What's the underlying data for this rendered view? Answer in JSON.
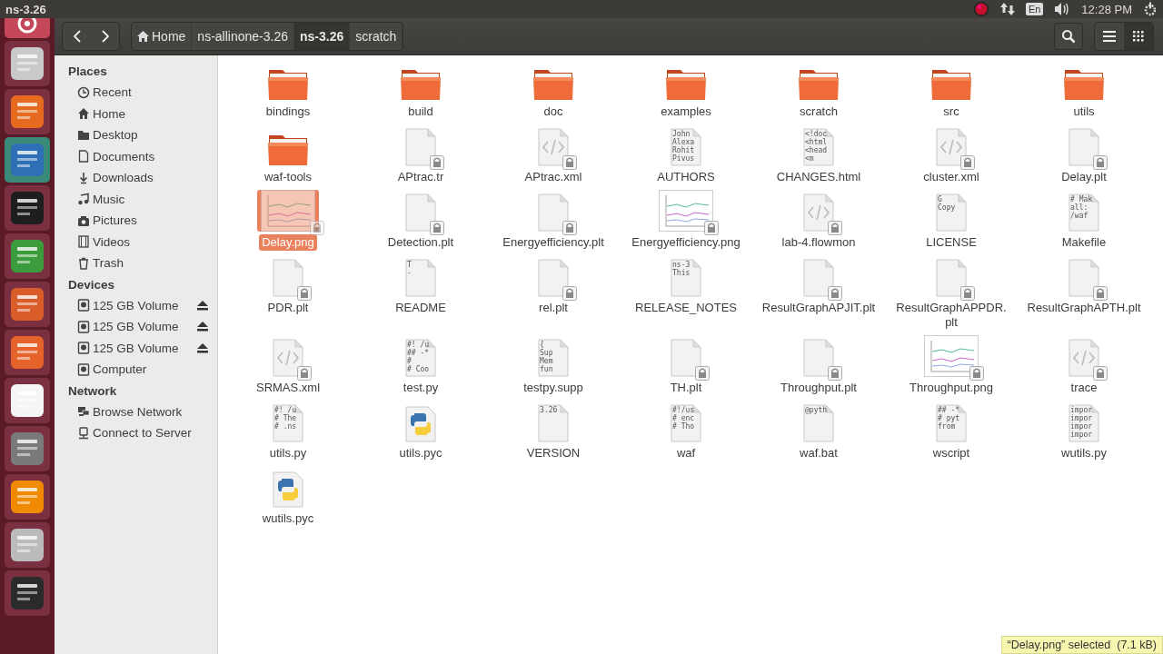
{
  "top_panel": {
    "title": "ns-3.26",
    "keyboard": "En",
    "clock": "12:28 PM"
  },
  "toolbar": {
    "path": [
      {
        "label": "Home",
        "selected": false
      },
      {
        "label": "ns-allinone-3.26",
        "selected": false
      },
      {
        "label": "ns-3.26",
        "selected": true
      },
      {
        "label": "scratch",
        "selected": false
      }
    ],
    "views": [
      {
        "kind": "list",
        "selected": false
      },
      {
        "kind": "grid",
        "selected": true
      }
    ]
  },
  "sidebar": {
    "sections": [
      {
        "title": "Places",
        "items": [
          {
            "label": "Recent"
          },
          {
            "label": "Home"
          },
          {
            "label": "Desktop"
          },
          {
            "label": "Documents"
          },
          {
            "label": "Downloads"
          },
          {
            "label": "Music"
          },
          {
            "label": "Pictures"
          },
          {
            "label": "Videos"
          },
          {
            "label": "Trash"
          }
        ]
      },
      {
        "title": "Devices",
        "items": [
          {
            "label": "125 GB Volume",
            "ejectable": true
          },
          {
            "label": "125 GB Volume",
            "ejectable": true
          },
          {
            "label": "125 GB Volume",
            "ejectable": true
          },
          {
            "label": "Computer",
            "ejectable": false
          }
        ]
      },
      {
        "title": "Network",
        "items": [
          {
            "label": "Browse Network"
          },
          {
            "label": "Connect to Server"
          }
        ]
      }
    ]
  },
  "files": [
    {
      "name": "bindings",
      "kind": "folder",
      "selected": false
    },
    {
      "name": "build",
      "kind": "folder",
      "selected": false
    },
    {
      "name": "doc",
      "kind": "folder",
      "selected": false
    },
    {
      "name": "examples",
      "kind": "folder",
      "selected": false
    },
    {
      "name": "scratch",
      "kind": "folder",
      "selected": false
    },
    {
      "name": "src",
      "kind": "folder",
      "selected": false
    },
    {
      "name": "utils",
      "kind": "folder",
      "selected": false
    },
    {
      "name": "waf-tools",
      "kind": "folder",
      "selected": false
    },
    {
      "name": "APtrac.tr",
      "kind": "document",
      "locked": true,
      "selected": false
    },
    {
      "name": "APtrac.xml",
      "kind": "code",
      "locked": true,
      "selected": false
    },
    {
      "name": "AUTHORS",
      "kind": "text",
      "preview": [
        "John",
        "Alexa",
        "Rohit",
        "Pivus"
      ],
      "locked": false,
      "selected": false
    },
    {
      "name": "CHANGES.html",
      "kind": "text",
      "preview": [
        "<!doc",
        "<html",
        "<head",
        "<m"
      ],
      "locked": false,
      "selected": false
    },
    {
      "name": "cluster.xml",
      "kind": "code",
      "locked": true,
      "selected": false
    },
    {
      "name": "Delay.plt",
      "kind": "document",
      "locked": true,
      "selected": false
    },
    {
      "name": "Delay.png",
      "kind": "image",
      "locked": true,
      "selected": true
    },
    {
      "name": "Detection.plt",
      "kind": "document",
      "locked": true,
      "selected": false
    },
    {
      "name": "Energyefficiency.plt",
      "kind": "document",
      "locked": true,
      "selected": false
    },
    {
      "name": "Energyefficiency.png",
      "kind": "image",
      "locked": true,
      "selected": false
    },
    {
      "name": "lab-4.flowmon",
      "kind": "code",
      "locked": true,
      "selected": false
    },
    {
      "name": "LICENSE",
      "kind": "text",
      "preview": [
        "G",
        "Copy"
      ],
      "locked": false,
      "selected": false
    },
    {
      "name": "Makefile",
      "kind": "text",
      "preview": [
        "# Mak",
        "all:",
        "/waf"
      ],
      "locked": false,
      "selected": false
    },
    {
      "name": "PDR.plt",
      "kind": "document",
      "locked": true,
      "selected": false
    },
    {
      "name": "README",
      "kind": "text",
      "preview": [
        "T",
        "-"
      ],
      "locked": false,
      "selected": false
    },
    {
      "name": "rel.plt",
      "kind": "document",
      "locked": true,
      "selected": false
    },
    {
      "name": "RELEASE_NOTES",
      "kind": "text",
      "preview": [
        "ns-3",
        "This"
      ],
      "locked": false,
      "selected": false
    },
    {
      "name": "ResultGraphAPJIT.plt",
      "kind": "document",
      "locked": true,
      "selected": false
    },
    {
      "name": "ResultGraphAPPDR.plt",
      "kind": "document",
      "locked": true,
      "selected": false
    },
    {
      "name": "ResultGraphAPTH.plt",
      "kind": "document",
      "locked": true,
      "selected": false
    },
    {
      "name": "SRMAS.xml",
      "kind": "code",
      "locked": true,
      "selected": false
    },
    {
      "name": "test.py",
      "kind": "text",
      "preview": [
        "#! /u",
        "## -*",
        "#",
        "# Coo"
      ],
      "locked": false,
      "selected": false
    },
    {
      "name": "testpy.supp",
      "kind": "text",
      "preview": [
        "{",
        "Sup",
        "Mem",
        "fun"
      ],
      "locked": false,
      "selected": false
    },
    {
      "name": "TH.plt",
      "kind": "document",
      "locked": true,
      "selected": false
    },
    {
      "name": "Throughput.plt",
      "kind": "document",
      "locked": true,
      "selected": false
    },
    {
      "name": "Throughput.png",
      "kind": "image",
      "locked": true,
      "selected": false
    },
    {
      "name": "trace",
      "kind": "code",
      "locked": true,
      "selected": false
    },
    {
      "name": "utils.py",
      "kind": "text",
      "preview": [
        "#! /u",
        "# The",
        "# .ns"
      ],
      "locked": false,
      "selected": false
    },
    {
      "name": "utils.pyc",
      "kind": "python",
      "selected": false
    },
    {
      "name": "VERSION",
      "kind": "text",
      "preview": [
        "3.26"
      ],
      "locked": false,
      "selected": false
    },
    {
      "name": "waf",
      "kind": "text",
      "preview": [
        "#!/us",
        "# enc",
        "# Tho"
      ],
      "locked": false,
      "selected": false
    },
    {
      "name": "waf.bat",
      "kind": "text",
      "preview": [
        "@pyth"
      ],
      "locked": false,
      "selected": false
    },
    {
      "name": "wscript",
      "kind": "text",
      "preview": [
        "## -*",
        "# pyt",
        "from"
      ],
      "locked": false,
      "selected": false
    },
    {
      "name": "wutils.py",
      "kind": "text",
      "preview": [
        "impor",
        "impor",
        "impor",
        "impor"
      ],
      "locked": false,
      "selected": false
    },
    {
      "name": "wutils.pyc",
      "kind": "python",
      "selected": false
    }
  ],
  "status": "“Delay.png” selected  (7.1 kB)"
}
